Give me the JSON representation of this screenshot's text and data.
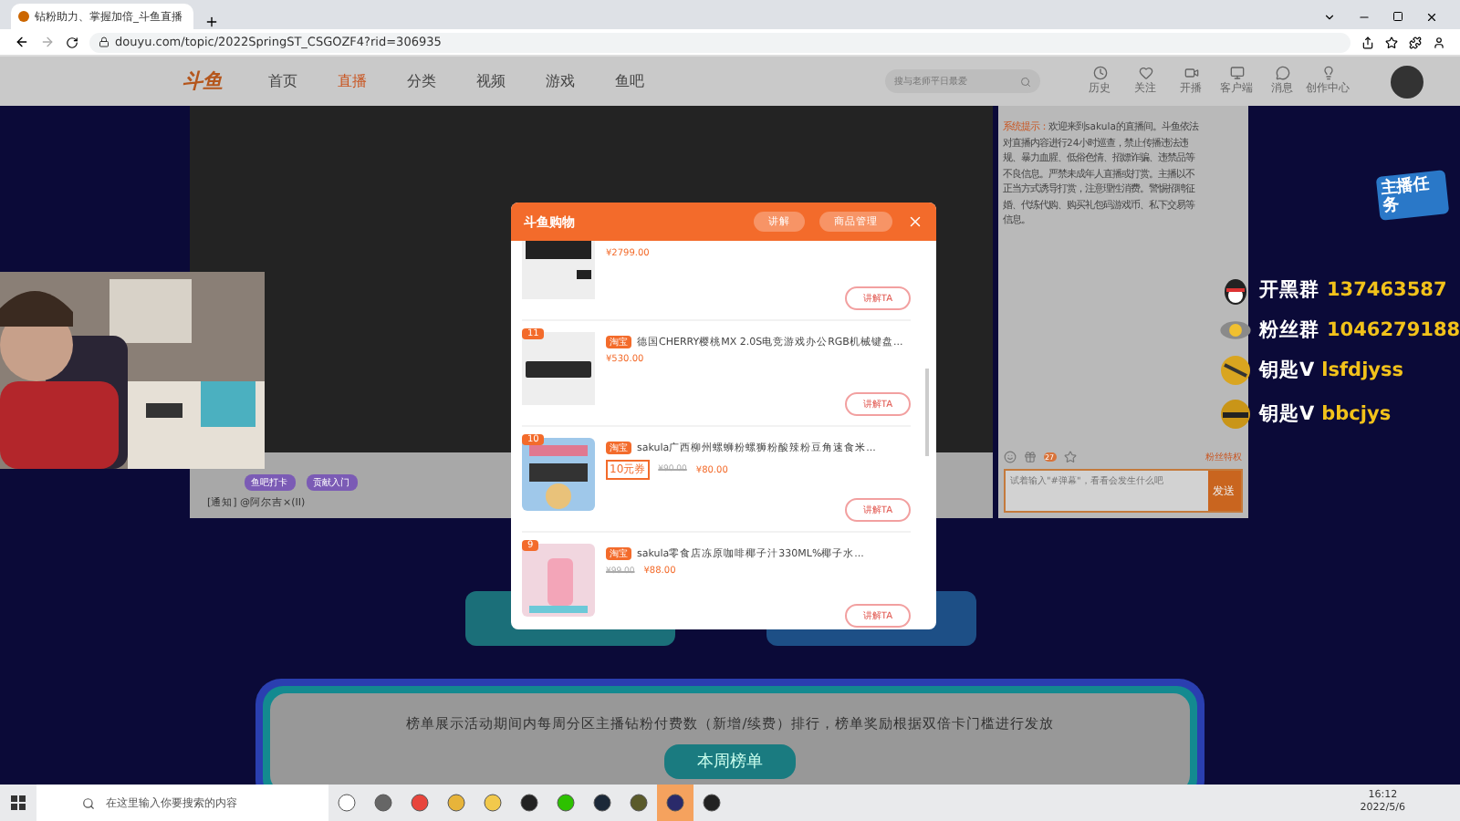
{
  "browser": {
    "tab_title": "钻粉助力、掌握加倍_斗鱼直播",
    "url": "douyu.com/topic/2022SpringST_CSGOZF4?rid=306935"
  },
  "site_header": {
    "logo": "斗鱼",
    "nav": [
      {
        "label": "首页",
        "selected": false
      },
      {
        "label": "直播",
        "selected": true
      },
      {
        "label": "分类",
        "selected": false
      },
      {
        "label": "视频",
        "selected": false
      },
      {
        "label": "游戏",
        "selected": false
      },
      {
        "label": "鱼吧",
        "selected": false
      }
    ],
    "search": {
      "placeholder": "搜与老师平日最爱"
    },
    "tools": [
      {
        "label": "历史"
      },
      {
        "label": "关注"
      },
      {
        "label": "开播"
      },
      {
        "label": "客户端"
      },
      {
        "label": "消息"
      },
      {
        "label": "创作中心"
      }
    ]
  },
  "video_bar": {
    "badges": [
      "鱼吧打卡",
      "贡献入门"
    ],
    "notice": "[通知] @阿尔吉×(II)"
  },
  "chat": {
    "system_label": "系统提示：",
    "system_text": "欢迎来到sakula的直播间。斗鱼依法对直播内容进行24小时巡查，禁止传播违法违规、暴力血腥、低俗色情、招嫖诈骗、违禁品等不良信息。严禁未成年人直播或打赏。主播以不正当方式诱导打赏，注意理性消费。警惕招聘征婚、代练代购、购买礼包码游戏币、私下交易等信息。",
    "gift_count": "27",
    "fan_privilege": "粉丝特权",
    "input_placeholder": "试着输入\"#弹幕\"，看看会发生什么吧",
    "send": "发送"
  },
  "overlay": {
    "task_badge": "主播任务",
    "groups": [
      {
        "kind": "qq",
        "label": "开黑群",
        "value": "137463587"
      },
      {
        "kind": "coin",
        "label": "粉丝群",
        "value": "1046279188"
      },
      {
        "kind": "key",
        "label": "钥匙V",
        "value": "lsfdjyss"
      },
      {
        "kind": "key2",
        "label": "钥匙V",
        "value": "bbcjys"
      }
    ]
  },
  "shop_modal": {
    "title": "斗鱼购物",
    "buttons": [
      "讲解",
      "商品管理"
    ],
    "items": [
      {
        "price": "¥2799.00",
        "action": "讲解TA"
      },
      {
        "rank": "11",
        "tag": "淘宝",
        "title": "德国CHERRY樱桃MX 2.0S电竞游戏办公RGB机械键盘...",
        "price": "¥530.00",
        "action": "讲解TA"
      },
      {
        "rank": "10",
        "tag": "淘宝",
        "title": "sakula广西柳州螺蛳粉螺狮粉酸辣粉豆角速食米...",
        "coupon": "10元券",
        "old_price": "¥90.00",
        "price": "¥80.00",
        "action": "讲解TA"
      },
      {
        "rank": "9",
        "tag": "淘宝",
        "title": "sakula零食店冻原咖啡椰子汁330ML%椰子水...",
        "old_price": "¥99.00",
        "price": "¥88.00",
        "action": "讲解TA"
      }
    ]
  },
  "ranking": {
    "description": "榜单展示活动期间内每周分区主播钻粉付费数（新增/续费）排行，榜单奖励根据双倍卡门槛进行发放",
    "button": "本周榜单"
  },
  "taskbar": {
    "search_placeholder": "在这里输入你要搜索的内容",
    "time": "16:12",
    "date": "2022/5/6"
  }
}
